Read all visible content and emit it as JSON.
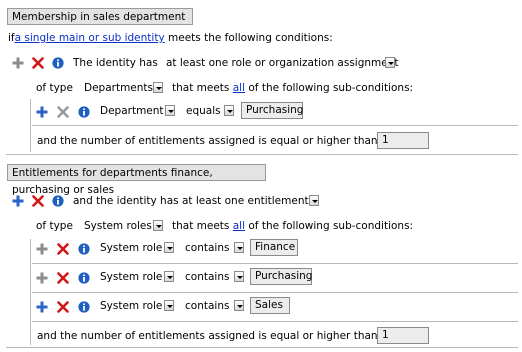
{
  "block1": {
    "header": "Membership in sales department",
    "line_prefix": "if",
    "line_link": "a single main or sub identity",
    "line_suffix": "meets the following conditions:",
    "condition": {
      "prefix": "The identity has",
      "select": "at least one role or organization assignment",
      "of_type_label": "of type",
      "type_value": "Departments",
      "meets_prefix": "that meets",
      "meets_link": "all",
      "meets_suffix": "of the following sub-conditions:",
      "sub": {
        "field": "Department",
        "op": "equals",
        "value": "Purchasing"
      },
      "count_label": "and the number of entitlements assigned is equal or higher than",
      "count_value": "1"
    }
  },
  "block2": {
    "header": "Entitlements for departments finance, purchasing or sales",
    "condition": {
      "prefix": "and the identity has",
      "select": "at least one entitlement",
      "of_type_label": "of type",
      "type_value": "System roles",
      "meets_prefix": "that meets",
      "meets_link": "all",
      "meets_suffix": "of the following sub-conditions:",
      "subs": [
        {
          "field": "System role",
          "op": "contains",
          "value": "Finance"
        },
        {
          "field": "System role",
          "op": "contains",
          "value": "Purchasing"
        },
        {
          "field": "System role",
          "op": "contains",
          "value": "Sales"
        }
      ],
      "count_label": "and the number of entitlements assigned is equal or higher than",
      "count_value": "1"
    }
  },
  "icons": {
    "add": "plus-icon",
    "remove": "delete-x-icon",
    "info": "info-icon",
    "dropdown": "chevron-down-icon"
  },
  "colors": {
    "plus_gray": "#8c8c8c",
    "plus_blue": "#2b63c8",
    "delete_red": "#d01818",
    "delete_gray": "#9a9a9a",
    "info_blue": "#1f5fbf",
    "link": "#0b2ec9",
    "header_bg": "#e3e3e3",
    "value_bg": "#ececec"
  }
}
